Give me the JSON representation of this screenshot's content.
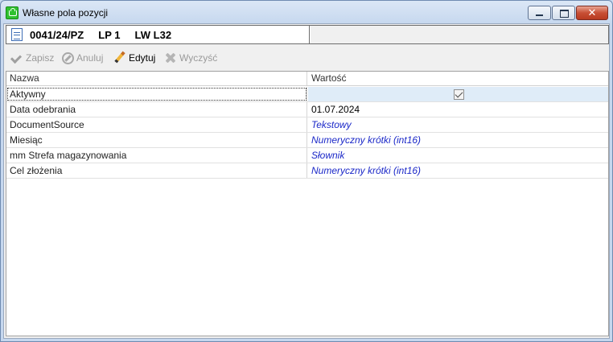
{
  "window": {
    "title": "Własne pola pozycji",
    "close_glyph": "✕"
  },
  "document_header": {
    "title": "0041/24/PZ     LP 1     LW L32"
  },
  "toolbar": {
    "save_label": "Zapisz",
    "cancel_label": "Anuluj",
    "edit_label": "Edytuj",
    "clear_label": "Wyczyść"
  },
  "grid": {
    "columns": [
      "Nazwa",
      "Wartość"
    ],
    "rows": [
      {
        "name": "Aktywny",
        "value": "",
        "checked": true
      },
      {
        "name": "Data odebrania",
        "value": "01.07.2024"
      },
      {
        "name": "DocumentSource",
        "value": "Tekstowy"
      },
      {
        "name": "Miesiąc",
        "value": "Numeryczny krótki (int16)"
      },
      {
        "name": "mm Strefa magazynowania",
        "value": "Słownik"
      },
      {
        "name": "Cel złożenia",
        "value": "Numeryczny krótki (int16)"
      }
    ]
  },
  "colors": {
    "type_value": "#1b28c8",
    "selection": "#dfecf8",
    "close_button": "#c84f35"
  }
}
